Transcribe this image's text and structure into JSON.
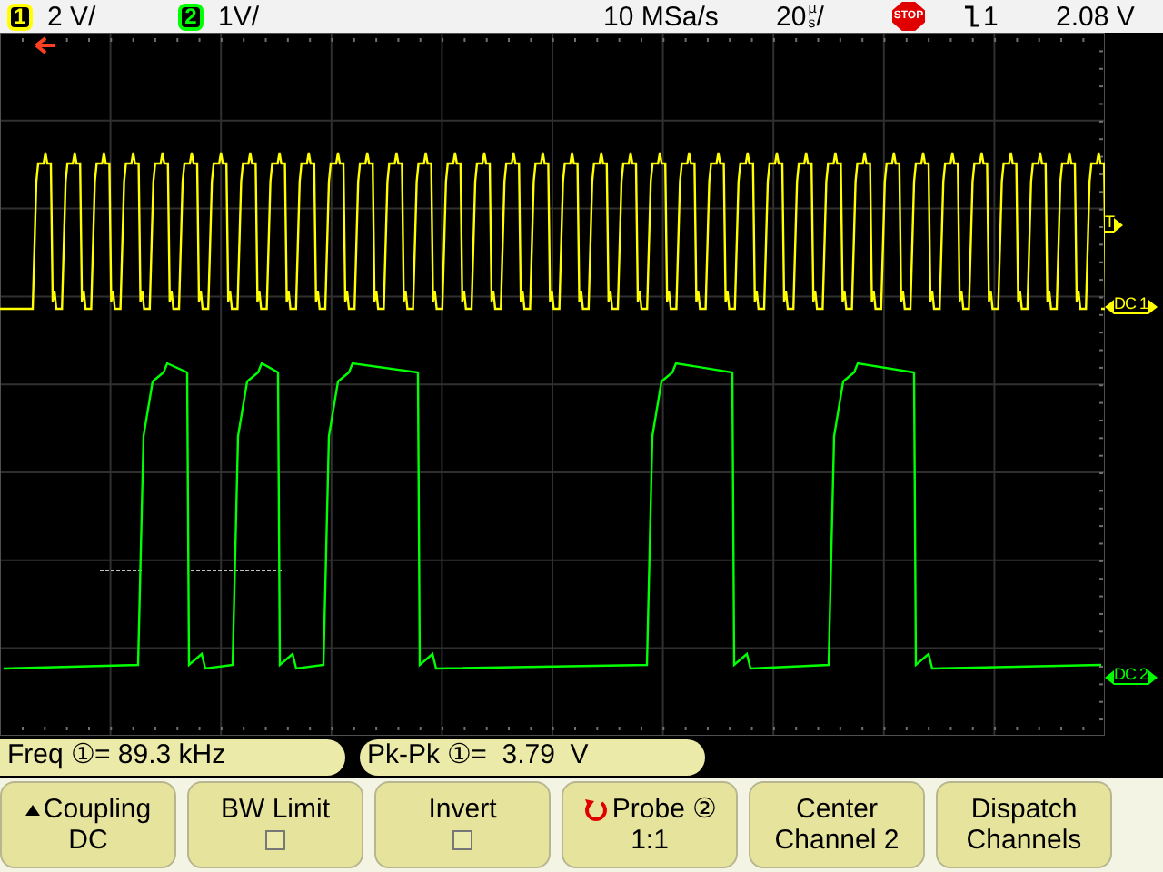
{
  "header": {
    "channels": [
      {
        "number": "1",
        "scale": "2 V/",
        "color": "#ffff00"
      },
      {
        "number": "2",
        "scale": "1V/",
        "color": "#00ff00"
      }
    ],
    "sample_rate": "10 MSa/s",
    "timebase": {
      "value": "20",
      "unit_top": "µ",
      "unit_bottom": "s",
      "slash": "/"
    },
    "run_state": "STOP",
    "trigger": {
      "source": "1",
      "level": "2.08 V"
    }
  },
  "markers": [
    {
      "label": "T",
      "color": "#ffff00",
      "kind": "trigger"
    },
    {
      "label": "DC 1",
      "color": "#ffff00",
      "kind": "ground"
    },
    {
      "label": "DC 2",
      "color": "#00ff00",
      "kind": "ground"
    }
  ],
  "measurements": [
    "Freq ①= 89.3 kHz",
    "Pk-Pk ①=  3.79  V"
  ],
  "softkeys": [
    {
      "kind": "menu",
      "label": "Coupling",
      "value": "DC"
    },
    {
      "kind": "checkbox",
      "label": "BW Limit",
      "checked": false
    },
    {
      "kind": "checkbox",
      "label": "Invert",
      "checked": false
    },
    {
      "kind": "rotate",
      "label": "Probe ②",
      "value": "1:1"
    },
    {
      "kind": "plain",
      "label": "Center",
      "value": "Channel 2"
    },
    {
      "kind": "plain",
      "label": "Dispatch",
      "value": "Channels"
    }
  ]
}
